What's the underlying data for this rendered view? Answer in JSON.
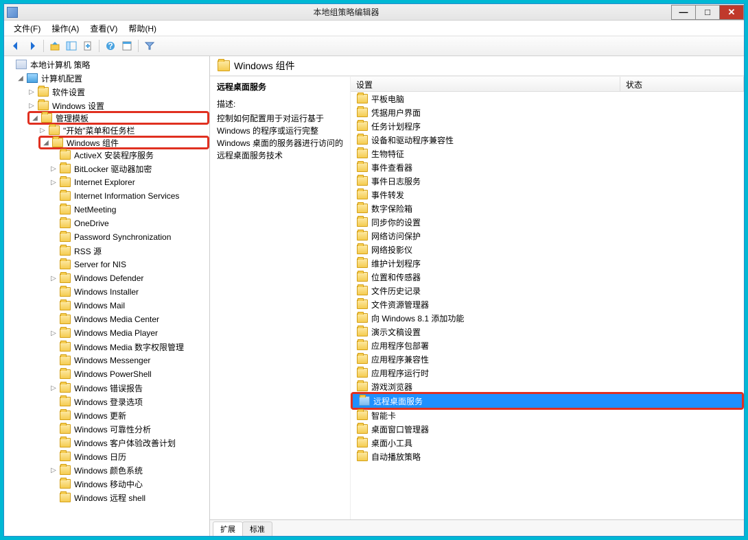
{
  "window": {
    "title": "本地组策略编辑器"
  },
  "menu": {
    "file": "文件(F)",
    "action": "操作(A)",
    "view": "查看(V)",
    "help": "帮助(H)"
  },
  "tree": {
    "root": "本地计算机 策略",
    "computer_config": "计算机配置",
    "software_settings": "软件设置",
    "windows_settings": "Windows 设置",
    "admin_templates": "管理模板",
    "start_taskbar": "\"开始\"菜单和任务栏",
    "windows_components": "Windows 组件",
    "items": [
      "ActiveX 安装程序服务",
      "BitLocker 驱动器加密",
      "Internet Explorer",
      "Internet Information Services",
      "NetMeeting",
      "OneDrive",
      "Password Synchronization",
      "RSS 源",
      "Server for NIS",
      "Windows Defender",
      "Windows Installer",
      "Windows Mail",
      "Windows Media Center",
      "Windows Media Player",
      "Windows Media 数字权限管理",
      "Windows Messenger",
      "Windows PowerShell",
      "Windows 错误报告",
      "Windows 登录选项",
      "Windows 更新",
      "Windows 可靠性分析",
      "Windows 客户体验改善计划",
      "Windows 日历",
      "Windows 颜色系统",
      "Windows 移动中心",
      "Windows 远程 shell"
    ],
    "tree_expandable_indices": [
      1,
      2,
      9,
      13,
      17,
      23
    ]
  },
  "right": {
    "header": "Windows 组件",
    "selected_title": "远程桌面服务",
    "desc_label": "描述:",
    "desc_text": "控制如何配置用于对运行基于 Windows 的程序或运行完整 Windows 桌面的服务器进行访问的远程桌面服务技术",
    "columns": {
      "setting": "设置",
      "state": "状态"
    },
    "items": [
      "平板电脑",
      "凭据用户界面",
      "任务计划程序",
      "设备和驱动程序兼容性",
      "生物特征",
      "事件查看器",
      "事件日志服务",
      "事件转发",
      "数字保险箱",
      "同步你的设置",
      "网络访问保护",
      "网络投影仪",
      "维护计划程序",
      "位置和传感器",
      "文件历史记录",
      "文件资源管理器",
      "向 Windows 8.1 添加功能",
      "演示文稿设置",
      "应用程序包部署",
      "应用程序兼容性",
      "应用程序运行时",
      "游戏浏览器",
      "远程桌面服务",
      "智能卡",
      "桌面窗口管理器",
      "桌面小工具",
      "自动播放策略"
    ],
    "selected_index": 22
  },
  "tabs": {
    "extended": "扩展",
    "standard": "标准"
  }
}
